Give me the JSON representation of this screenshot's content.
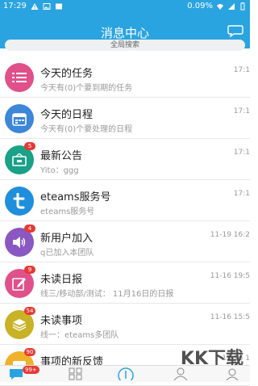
{
  "statusbar": {
    "time": "17:29",
    "battery": "0.09%",
    "signal_icons": [
      "warning-icon",
      "image-icon",
      "gallery-icon",
      "wifi-icon",
      "cell-signal-icon",
      "battery-icon"
    ]
  },
  "header": {
    "title": "消息中心",
    "chat_icon": "chat-bubble-icon"
  },
  "search": {
    "placeholder": "全局搜索"
  },
  "messages": [
    {
      "title": "今天的任务",
      "subtitle": "今天有(0)个要到期的任务",
      "time": "17:1",
      "badge": "",
      "icon": "list-icon",
      "color": "#e0508a"
    },
    {
      "title": "今天的日程",
      "subtitle": "今天有(0)个要处理的日程",
      "time": "17:1",
      "badge": "",
      "icon": "calendar-icon",
      "color": "#3d86d8"
    },
    {
      "title": "最新公告",
      "subtitle": "Yito：ggg",
      "time": "17:1",
      "badge": "5",
      "icon": "announcement-icon",
      "color": "#1aa188"
    },
    {
      "title": "eteams服务号",
      "subtitle": "eteams服务号",
      "time": "17:1",
      "badge": "",
      "icon": "service-t-icon",
      "color": "#1f8fdc"
    },
    {
      "title": "新用户加入",
      "subtitle": "q已加入本团队",
      "time": "11-19 16:2",
      "badge": "4",
      "icon": "speaker-icon",
      "color": "#8a58c2"
    },
    {
      "title": "未读日报",
      "subtitle": "线三/移动部/测试： 11月16日的日报",
      "time": "11-16 19:5",
      "badge": "9",
      "icon": "edit-icon",
      "color": "#e0508a"
    },
    {
      "title": "未读事项",
      "subtitle": "线一：eteams多团队",
      "time": "11-16 15:5",
      "badge": "54",
      "icon": "layers-icon",
      "color": "#c8b225"
    },
    {
      "title": "事项的新反馈",
      "subtitle": "",
      "time": "11-16 1",
      "badge": "90",
      "icon": "feedback-icon",
      "color": "#f0b22a"
    }
  ],
  "tabbar": {
    "badge": "99+",
    "tabs": [
      "message-tab-icon",
      "apps-tab-icon",
      "add-tab-icon",
      "contacts-tab-icon",
      "profile-tab-icon"
    ]
  },
  "watermark": "KK下载"
}
